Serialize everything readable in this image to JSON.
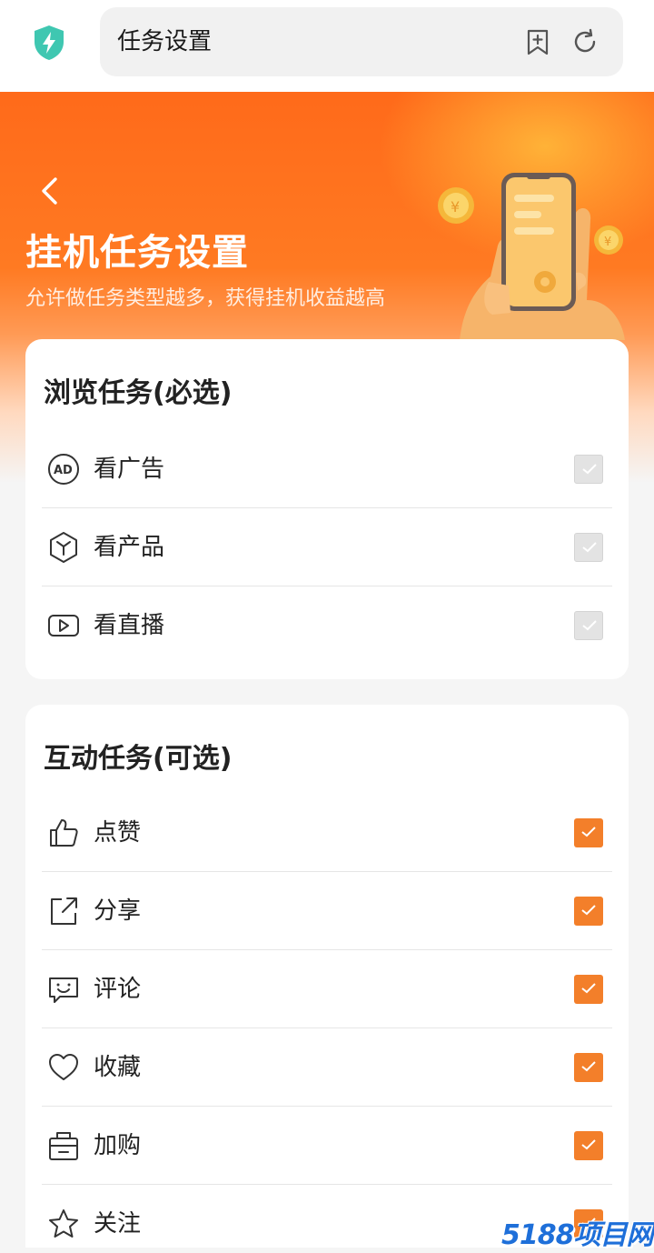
{
  "browser": {
    "url_title": "任务设置",
    "icons": [
      "shield-bolt-icon",
      "bookmark-add-icon",
      "refresh-icon"
    ]
  },
  "hero": {
    "title": "挂机任务设置",
    "subtitle": "允许做任务类型越多，获得挂机收益越高",
    "back_icon": "chevron-left-icon"
  },
  "browse_section": {
    "title": "浏览任务(必选)",
    "items": [
      {
        "label": "看广告",
        "icon": "ad-icon",
        "checked": true,
        "disabled": true
      },
      {
        "label": "看产品",
        "icon": "cube-icon",
        "checked": true,
        "disabled": true
      },
      {
        "label": "看直播",
        "icon": "play-icon",
        "checked": true,
        "disabled": true
      }
    ]
  },
  "interact_section": {
    "title": "互动任务(可选)",
    "items": [
      {
        "label": "点赞",
        "icon": "thumbs-up-icon",
        "checked": true
      },
      {
        "label": "分享",
        "icon": "share-icon",
        "checked": true
      },
      {
        "label": "评论",
        "icon": "comment-icon",
        "checked": true
      },
      {
        "label": "收藏",
        "icon": "heart-icon",
        "checked": true
      },
      {
        "label": "加购",
        "icon": "bag-icon",
        "checked": true
      },
      {
        "label": "关注",
        "icon": "star-icon",
        "checked": true
      }
    ]
  },
  "colors": {
    "accent": "#f37f2a",
    "hero_orange": "#ff6a1a",
    "checkbox_disabled": "#e3e3e3"
  },
  "watermark": {
    "text": "5188项目网"
  }
}
